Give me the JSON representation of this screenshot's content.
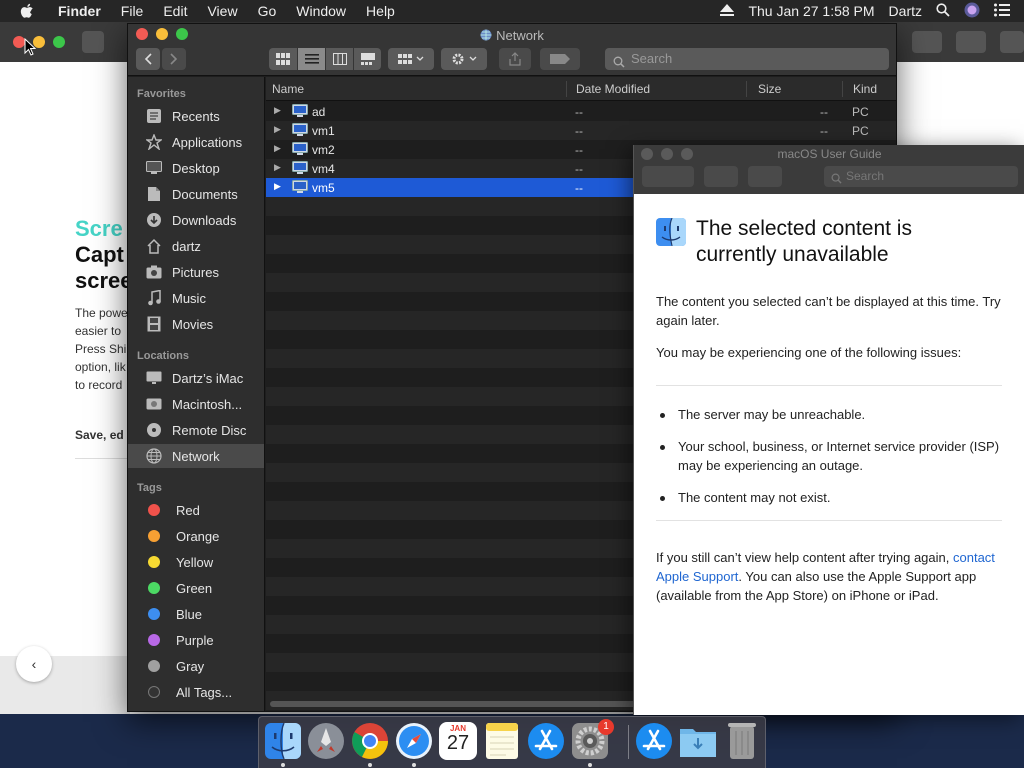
{
  "menubar": {
    "app": "Finder",
    "items": [
      "File",
      "Edit",
      "View",
      "Go",
      "Window",
      "Help"
    ],
    "datetime": "Thu Jan 27  1:58 PM",
    "user": "Dartz"
  },
  "browser": {
    "heading_accent": "Scre",
    "heading": "Capt scree",
    "paragraph": "The powe easier to Press Shi option, lik to record",
    "save_line": "Save, ed",
    "back": "‹"
  },
  "finder": {
    "title": "Network",
    "search_placeholder": "Search",
    "sidebar": {
      "favorites_header": "Favorites",
      "favorites": [
        {
          "label": "Recents",
          "icon": "clock-icon"
        },
        {
          "label": "Applications",
          "icon": "applications-icon"
        },
        {
          "label": "Desktop",
          "icon": "desktop-icon"
        },
        {
          "label": "Documents",
          "icon": "document-icon"
        },
        {
          "label": "Downloads",
          "icon": "download-icon"
        },
        {
          "label": "dartz",
          "icon": "home-icon"
        },
        {
          "label": "Pictures",
          "icon": "camera-icon"
        },
        {
          "label": "Music",
          "icon": "music-icon"
        },
        {
          "label": "Movies",
          "icon": "film-icon"
        }
      ],
      "locations_header": "Locations",
      "locations": [
        {
          "label": "Dartz’s iMac",
          "icon": "imac-icon"
        },
        {
          "label": "Macintosh...",
          "icon": "disk-icon"
        },
        {
          "label": "Remote Disc",
          "icon": "cd-icon"
        },
        {
          "label": "Network",
          "icon": "globe-icon"
        }
      ],
      "tags_header": "Tags",
      "tags": [
        {
          "label": "Red",
          "color": "#f0524b"
        },
        {
          "label": "Orange",
          "color": "#f7a033"
        },
        {
          "label": "Yellow",
          "color": "#f6d932"
        },
        {
          "label": "Green",
          "color": "#4cd964"
        },
        {
          "label": "Blue",
          "color": "#3d8ef0"
        },
        {
          "label": "Purple",
          "color": "#b868e6"
        },
        {
          "label": "Gray",
          "color": "#a0a0a0"
        },
        {
          "label": "All Tags...",
          "color": "#555555"
        }
      ]
    },
    "columns": {
      "name": "Name",
      "date": "Date Modified",
      "size": "Size",
      "kind": "Kind"
    },
    "rows": [
      {
        "name": "ad",
        "date": "--",
        "size": "--",
        "kind": "PC"
      },
      {
        "name": "vm1",
        "date": "--",
        "size": "--",
        "kind": "PC"
      },
      {
        "name": "vm2",
        "date": "--",
        "size": "",
        "kind": ""
      },
      {
        "name": "vm4",
        "date": "--",
        "size": "",
        "kind": ""
      },
      {
        "name": "vm5",
        "date": "--",
        "size": "",
        "kind": ""
      }
    ]
  },
  "help": {
    "title": "macOS User Guide",
    "search_placeholder": "Search",
    "heading": "The selected content is currently unavailable",
    "p1": "The content you selected can’t be displayed at this time. Try again later.",
    "p2": "You may be experiencing one of the following issues:",
    "bullets": [
      "The server may be unreachable.",
      "Your school, business, or Internet service provider (ISP) may be experiencing an outage.",
      "The content may not exist."
    ],
    "p3_before": "If you still can’t view help content after trying again, ",
    "p3_link": "contact Apple Support",
    "p3_after": ". You can also use the Apple Support app (available from the App Store) on iPhone or iPad."
  },
  "dock": {
    "calendar_month": "JAN",
    "calendar_day": "27",
    "badge": "1"
  }
}
